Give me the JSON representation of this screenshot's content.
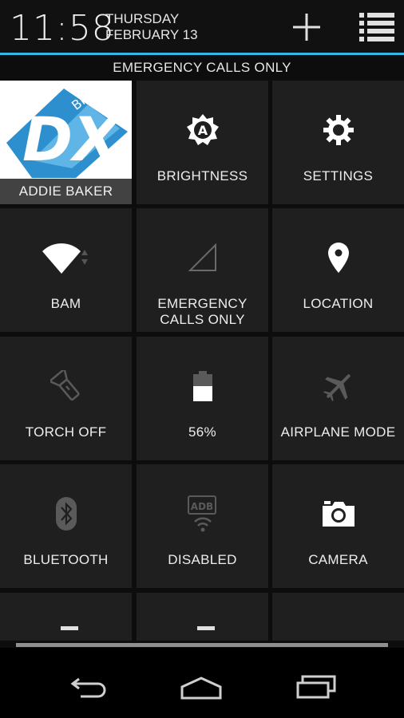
{
  "status": {
    "time": "11:58",
    "day": "THURSDAY",
    "date": "FEBRUARY 13",
    "emergency": "EMERGENCY CALLS ONLY"
  },
  "header_icons": {
    "add": "plus-icon",
    "menu": "list-settings-icon"
  },
  "tiles": {
    "user": {
      "label": "ADDIE BAKER",
      "avatar_logo": "BIG DX"
    },
    "brightness": {
      "label": "BRIGHTNESS",
      "icon": "brightness-auto-icon"
    },
    "settings": {
      "label": "SETTINGS",
      "icon": "gear-icon"
    },
    "wifi": {
      "label": "BAM",
      "icon": "wifi-icon"
    },
    "signal": {
      "line1": "EMERGENCY",
      "line2": "CALLS ONLY",
      "icon": "cell-signal-icon"
    },
    "location": {
      "label": "LOCATION",
      "icon": "location-pin-icon"
    },
    "torch": {
      "label": "TORCH OFF",
      "icon": "flashlight-icon"
    },
    "battery": {
      "label": "56%",
      "icon": "battery-icon",
      "level": 0.56
    },
    "airplane": {
      "label": "AIRPLANE MODE",
      "icon": "airplane-icon"
    },
    "bluetooth": {
      "label": "BLUETOOTH",
      "icon": "bluetooth-icon"
    },
    "adb": {
      "label": "DISABLED",
      "icon": "adb-icon",
      "icon_text": "ADB"
    },
    "camera": {
      "label": "CAMERA",
      "icon": "camera-icon"
    }
  },
  "nav": {
    "back": "back-icon",
    "home": "home-icon",
    "recents": "recents-icon"
  },
  "colors": {
    "accent": "#33b5e5",
    "tile_bg": "#1f1f1f",
    "background": "#0d0d0d"
  }
}
